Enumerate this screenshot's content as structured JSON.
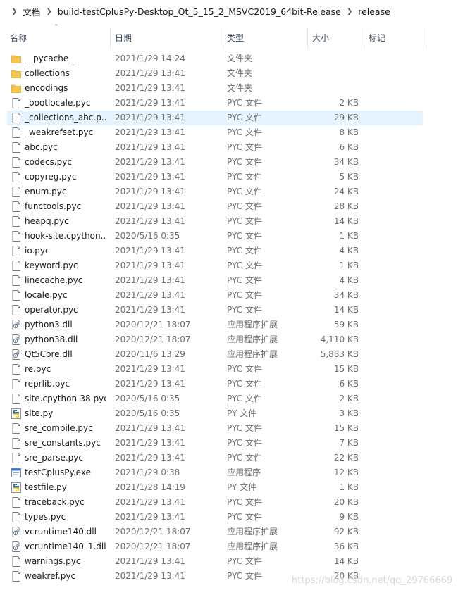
{
  "breadcrumb": [
    "文档",
    "build-testCplusPy-Desktop_Qt_5_15_2_MSVC2019_64bit-Release",
    "release"
  ],
  "columns": {
    "name": "名称",
    "date": "日期",
    "type": "类型",
    "size": "大小",
    "tag": "标记"
  },
  "files": [
    {
      "name": "__pycache__",
      "date": "2021/1/29 14:24",
      "type": "文件夹",
      "size": "",
      "icon": "folder-icon"
    },
    {
      "name": "collections",
      "date": "2021/1/29 13:41",
      "type": "文件夹",
      "size": "",
      "icon": "folder-icon"
    },
    {
      "name": "encodings",
      "date": "2021/1/29 13:41",
      "type": "文件夹",
      "size": "",
      "icon": "folder-icon"
    },
    {
      "name": "_bootlocale.pyc",
      "date": "2021/1/29 13:41",
      "type": "PYC 文件",
      "size": "2 KB",
      "icon": "file-icon"
    },
    {
      "name": "_collections_abc.p...",
      "date": "2021/1/29 13:41",
      "type": "PYC 文件",
      "size": "29 KB",
      "icon": "file-icon"
    },
    {
      "name": "_weakrefset.pyc",
      "date": "2021/1/29 13:41",
      "type": "PYC 文件",
      "size": "8 KB",
      "icon": "file-icon"
    },
    {
      "name": "abc.pyc",
      "date": "2021/1/29 13:41",
      "type": "PYC 文件",
      "size": "6 KB",
      "icon": "file-icon"
    },
    {
      "name": "codecs.pyc",
      "date": "2021/1/29 13:41",
      "type": "PYC 文件",
      "size": "34 KB",
      "icon": "file-icon"
    },
    {
      "name": "copyreg.pyc",
      "date": "2021/1/29 13:41",
      "type": "PYC 文件",
      "size": "5 KB",
      "icon": "file-icon"
    },
    {
      "name": "enum.pyc",
      "date": "2021/1/29 13:41",
      "type": "PYC 文件",
      "size": "24 KB",
      "icon": "file-icon"
    },
    {
      "name": "functools.pyc",
      "date": "2021/1/29 13:41",
      "type": "PYC 文件",
      "size": "28 KB",
      "icon": "file-icon"
    },
    {
      "name": "heapq.pyc",
      "date": "2021/1/29 13:41",
      "type": "PYC 文件",
      "size": "14 KB",
      "icon": "file-icon"
    },
    {
      "name": "hook-site.cpython...",
      "date": "2020/5/16 0:35",
      "type": "PYC 文件",
      "size": "1 KB",
      "icon": "file-icon"
    },
    {
      "name": "io.pyc",
      "date": "2021/1/29 13:41",
      "type": "PYC 文件",
      "size": "4 KB",
      "icon": "file-icon"
    },
    {
      "name": "keyword.pyc",
      "date": "2021/1/29 13:41",
      "type": "PYC 文件",
      "size": "1 KB",
      "icon": "file-icon"
    },
    {
      "name": "linecache.pyc",
      "date": "2021/1/29 13:41",
      "type": "PYC 文件",
      "size": "4 KB",
      "icon": "file-icon"
    },
    {
      "name": "locale.pyc",
      "date": "2021/1/29 13:41",
      "type": "PYC 文件",
      "size": "34 KB",
      "icon": "file-icon"
    },
    {
      "name": "operator.pyc",
      "date": "2021/1/29 13:41",
      "type": "PYC 文件",
      "size": "14 KB",
      "icon": "file-icon"
    },
    {
      "name": "python3.dll",
      "date": "2020/12/21 18:07",
      "type": "应用程序扩展",
      "size": "59 KB",
      "icon": "dll-icon"
    },
    {
      "name": "python38.dll",
      "date": "2020/12/21 18:07",
      "type": "应用程序扩展",
      "size": "4,110 KB",
      "icon": "dll-icon"
    },
    {
      "name": "Qt5Core.dll",
      "date": "2020/11/6 13:29",
      "type": "应用程序扩展",
      "size": "5,883 KB",
      "icon": "dll-icon"
    },
    {
      "name": "re.pyc",
      "date": "2021/1/29 13:41",
      "type": "PYC 文件",
      "size": "15 KB",
      "icon": "file-icon"
    },
    {
      "name": "reprlib.pyc",
      "date": "2021/1/29 13:41",
      "type": "PYC 文件",
      "size": "6 KB",
      "icon": "file-icon"
    },
    {
      "name": "site.cpython-38.pyc",
      "date": "2020/5/16 0:35",
      "type": "PYC 文件",
      "size": "2 KB",
      "icon": "file-icon"
    },
    {
      "name": "site.py",
      "date": "2020/5/16 0:35",
      "type": "PY 文件",
      "size": "3 KB",
      "icon": "python-icon"
    },
    {
      "name": "sre_compile.pyc",
      "date": "2021/1/29 13:41",
      "type": "PYC 文件",
      "size": "15 KB",
      "icon": "file-icon"
    },
    {
      "name": "sre_constants.pyc",
      "date": "2021/1/29 13:41",
      "type": "PYC 文件",
      "size": "7 KB",
      "icon": "file-icon"
    },
    {
      "name": "sre_parse.pyc",
      "date": "2021/1/29 13:41",
      "type": "PYC 文件",
      "size": "22 KB",
      "icon": "file-icon"
    },
    {
      "name": "testCplusPy.exe",
      "date": "2021/1/29 0:38",
      "type": "应用程序",
      "size": "12 KB",
      "icon": "exe-icon"
    },
    {
      "name": "testfile.py",
      "date": "2021/1/28 14:19",
      "type": "PY 文件",
      "size": "1 KB",
      "icon": "python-icon"
    },
    {
      "name": "traceback.pyc",
      "date": "2021/1/29 13:41",
      "type": "PYC 文件",
      "size": "20 KB",
      "icon": "file-icon"
    },
    {
      "name": "types.pyc",
      "date": "2021/1/29 13:41",
      "type": "PYC 文件",
      "size": "9 KB",
      "icon": "file-icon"
    },
    {
      "name": "vcruntime140.dll",
      "date": "2020/12/21 18:07",
      "type": "应用程序扩展",
      "size": "92 KB",
      "icon": "dll-icon"
    },
    {
      "name": "vcruntime140_1.dll",
      "date": "2020/12/21 18:07",
      "type": "应用程序扩展",
      "size": "36 KB",
      "icon": "dll-icon"
    },
    {
      "name": "warnings.pyc",
      "date": "2021/1/29 13:41",
      "type": "PYC 文件",
      "size": "14 KB",
      "icon": "file-icon"
    },
    {
      "name": "weakref.pyc",
      "date": "2021/1/29 13:41",
      "type": "PYC 文件",
      "size": "20 KB",
      "icon": "file-icon"
    }
  ],
  "hovered_row": 4,
  "watermark": "https://blog.csdn.net/qq_29766669",
  "colors": {
    "hover": "#e5f3ff",
    "folder": "#f5c84c",
    "folder_dark": "#dcae34",
    "python_blue": "#3572a5",
    "python_yellow": "#ffd43b"
  }
}
